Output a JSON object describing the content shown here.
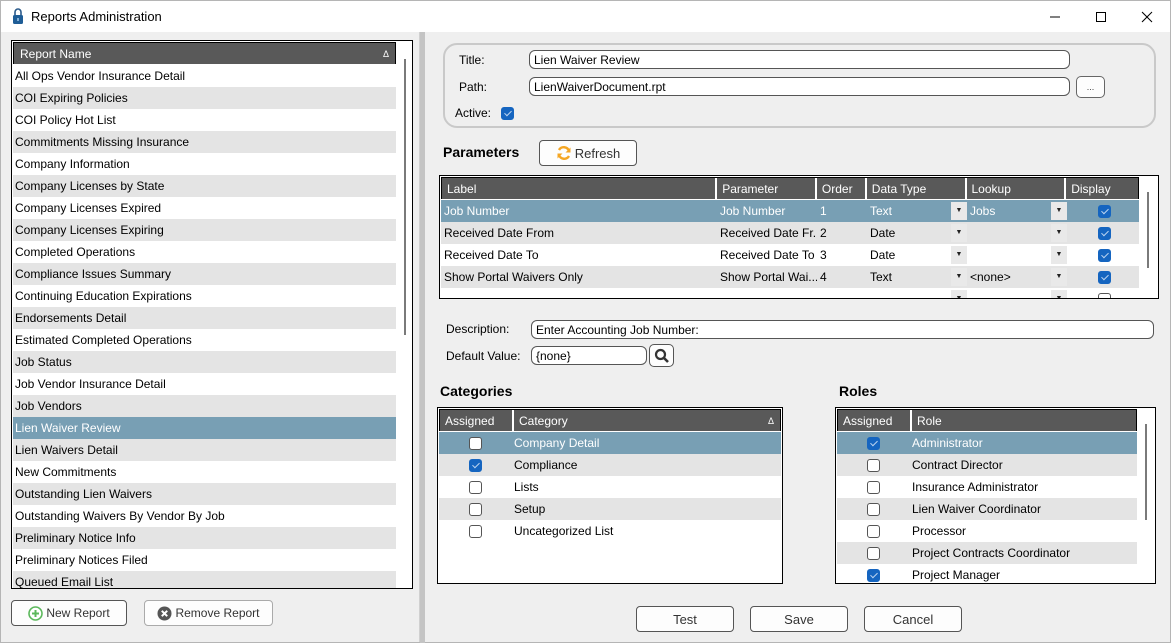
{
  "window": {
    "title": "Reports Administration",
    "controls": {
      "minimize": "—",
      "maximize": "☐",
      "close": "✕"
    }
  },
  "report_list": {
    "header": "Report Name",
    "sort_indicator": "Δ",
    "selected_index": 16,
    "items": [
      "All Ops Vendor Insurance Detail",
      "COI Expiring Policies",
      "COI Policy Hot List",
      "Commitments Missing Insurance",
      "Company Information",
      "Company Licenses by State",
      "Company Licenses Expired",
      "Company Licenses Expiring",
      "Completed Operations",
      "Compliance Issues Summary",
      "Continuing Education Expirations",
      "Endorsements Detail",
      "Estimated Completed Operations",
      "Job Status",
      "Job Vendor Insurance Detail",
      "Job Vendors",
      "Lien Waiver Review",
      "Lien Waivers Detail",
      "New Commitments",
      "Outstanding Lien Waivers",
      "Outstanding Waivers By Vendor By Job",
      "Preliminary Notice Info",
      "Preliminary Notices Filed",
      "Queued Email List"
    ],
    "new_button": "New Report",
    "remove_button": "Remove Report"
  },
  "properties": {
    "title_label": "Title:",
    "title_value": "Lien Waiver Review",
    "path_label": "Path:",
    "path_value": "LienWaiverDocument.rpt",
    "browse_button": "...",
    "active_label": "Active:",
    "active_checked": true
  },
  "parameters": {
    "section_title": "Parameters",
    "refresh_button": "Refresh",
    "columns": [
      "Label",
      "Parameter",
      "Order",
      "Data Type",
      "Lookup",
      "Display"
    ],
    "rows": [
      {
        "label": "Job Number",
        "parameter": "Job Number",
        "order": "1",
        "data_type": "Text",
        "lookup": "Jobs",
        "display": true,
        "selected": true
      },
      {
        "label": "Received Date From",
        "parameter": "Received Date Fr...",
        "order": "2",
        "data_type": "Date",
        "lookup": "",
        "display": true,
        "selected": false
      },
      {
        "label": "Received Date To",
        "parameter": "Received Date To",
        "order": "3",
        "data_type": "Date",
        "lookup": "",
        "display": true,
        "selected": false
      },
      {
        "label": "Show Portal Waivers Only",
        "parameter": "Show Portal Wai...",
        "order": "4",
        "data_type": "Text",
        "lookup": "<none>",
        "display": true,
        "selected": false
      },
      {
        "label": "",
        "parameter": "",
        "order": "",
        "data_type": "",
        "lookup": "",
        "display": false,
        "selected": false
      }
    ],
    "description_label": "Description:",
    "description_value": "Enter Accounting Job Number:",
    "default_label": "Default Value:",
    "default_value": "{none}"
  },
  "categories": {
    "section_title": "Categories",
    "columns": [
      "Assigned",
      "Category"
    ],
    "sort_indicator": "Δ",
    "rows": [
      {
        "name": "Company Detail",
        "assigned": false,
        "selected": true
      },
      {
        "name": "Compliance",
        "assigned": true,
        "selected": false
      },
      {
        "name": "Lists",
        "assigned": false,
        "selected": false
      },
      {
        "name": "Setup",
        "assigned": false,
        "selected": false
      },
      {
        "name": "Uncategorized List",
        "assigned": false,
        "selected": false
      }
    ]
  },
  "roles": {
    "section_title": "Roles",
    "columns": [
      "Assigned",
      "Role"
    ],
    "rows": [
      {
        "name": "Administrator",
        "assigned": true,
        "selected": true
      },
      {
        "name": "Contract Director",
        "assigned": false,
        "selected": false
      },
      {
        "name": "Insurance Administrator",
        "assigned": false,
        "selected": false
      },
      {
        "name": "Lien Waiver Coordinator",
        "assigned": false,
        "selected": false
      },
      {
        "name": "Processor",
        "assigned": false,
        "selected": false
      },
      {
        "name": "Project Contracts Coordinator",
        "assigned": false,
        "selected": false
      },
      {
        "name": "Project Manager",
        "assigned": true,
        "selected": false
      }
    ]
  },
  "actions": {
    "test": "Test",
    "save": "Save",
    "cancel": "Cancel"
  },
  "colors": {
    "selection": "#789fb4",
    "header": "#595959",
    "checkbox_checked": "#1565c0",
    "refresh_icon": "#f5a623",
    "add_icon": "#5cb85c"
  }
}
